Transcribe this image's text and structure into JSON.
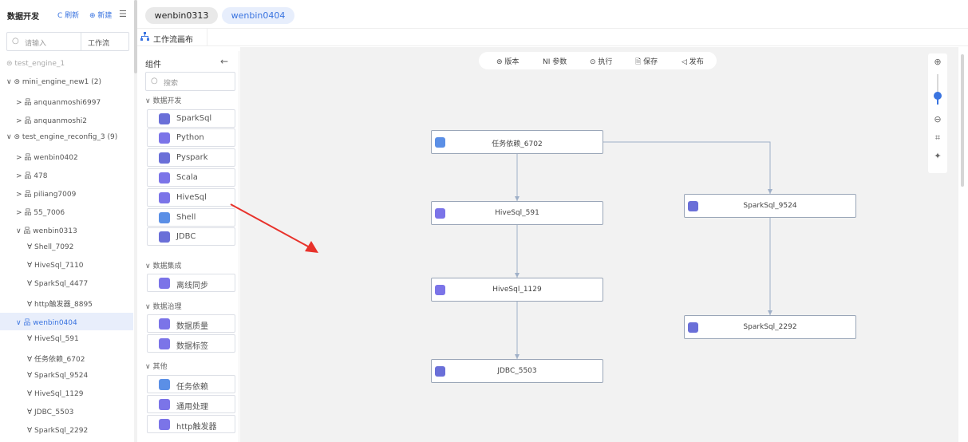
{
  "left_panel": {
    "title": "数据开发",
    "refresh_label": "C 刷新",
    "new_label": "⊕ 新建",
    "search_placeholder": "请输入",
    "filter_value": "工作流",
    "tree": [
      {
        "label": "⊜ test_engine_1",
        "state": "muted"
      },
      {
        "label": "∨ ⊜ mini_engine_new1 (2)"
      },
      {
        "label": "> 品 anquanmoshi6997"
      },
      {
        "label": "> 品 anquanmoshi2"
      },
      {
        "label": "∨ ⊜ test_engine_reconfig_3 (9)"
      },
      {
        "label": "> 品 wenbin0402"
      },
      {
        "label": "> 品 478"
      },
      {
        "label": "> 品 piliang7009"
      },
      {
        "label": "> 品 55_7006"
      },
      {
        "label": "∨ 品 wenbin0313"
      },
      {
        "label": "∀ Shell_7092"
      },
      {
        "label": "∀ HiveSql_7110"
      },
      {
        "label": "∀ SparkSql_4477"
      },
      {
        "label": "∀ http触发器_8895"
      },
      {
        "label": "∨ 品 wenbin0404",
        "state": "selected"
      },
      {
        "label": "∀ HiveSql_591"
      },
      {
        "label": "∀ 任务依赖_6702"
      },
      {
        "label": "∀ SparkSql_9524"
      },
      {
        "label": "∀ HiveSql_1129"
      },
      {
        "label": "∀ JDBC_5503"
      },
      {
        "label": "∀ SparkSql_2292"
      }
    ]
  },
  "tabs": [
    {
      "label": "wenbin0313",
      "active": false
    },
    {
      "label": "wenbin0404",
      "active": true
    }
  ],
  "subtab": {
    "label": "工作流画布"
  },
  "palette": {
    "title": "组件",
    "search_placeholder": "搜索",
    "groups": [
      {
        "label": "∨ 数据开发",
        "items": [
          {
            "label": "SparkSql",
            "icon": "spark-icon",
            "color": "#6a6fd8"
          },
          {
            "label": "Python",
            "icon": "python-icon",
            "color": "#7b74e8"
          },
          {
            "label": "Pyspark",
            "icon": "pyspark-icon",
            "color": "#6a6fd8"
          },
          {
            "label": "Scala",
            "icon": "scala-icon",
            "color": "#7b74e8"
          },
          {
            "label": "HiveSql",
            "icon": "hive-icon",
            "color": "#7b74e8"
          },
          {
            "label": "Shell",
            "icon": "shell-icon",
            "color": "#5b8fe6"
          },
          {
            "label": "JDBC",
            "icon": "jdbc-icon",
            "color": "#6a6fd8"
          }
        ]
      },
      {
        "label": "∨ 数据集成",
        "items": [
          {
            "label": "离线同步",
            "icon": "sync-icon",
            "color": "#7b74e8"
          }
        ]
      },
      {
        "label": "∨ 数据治理",
        "items": [
          {
            "label": "数据质量",
            "icon": "quality-icon",
            "color": "#7b74e8"
          },
          {
            "label": "数据标签",
            "icon": "tag-icon",
            "color": "#7b74e8"
          }
        ]
      },
      {
        "label": "∨ 其他",
        "items": [
          {
            "label": "任务依赖",
            "icon": "dependency-icon",
            "color": "#5b8fe6"
          },
          {
            "label": "通用处理",
            "icon": "general-icon",
            "color": "#7b74e8"
          },
          {
            "label": "http触发器",
            "icon": "http-icon",
            "color": "#7b74e8"
          }
        ]
      }
    ]
  },
  "toolbar": {
    "version": "⊜ 版本",
    "params": "NI 参数",
    "run": "⊙ 执行",
    "save": "🗎 保存",
    "publish": "◁ 发布"
  },
  "nodes": [
    {
      "id": "dep",
      "label": "任务依赖_6702",
      "icon": "dependency-icon",
      "color": "#5b8fe6"
    },
    {
      "id": "hive591",
      "label": "HiveSql_591",
      "icon": "hive-icon",
      "color": "#7b74e8"
    },
    {
      "id": "hive1129",
      "label": "HiveSql_1129",
      "icon": "hive-icon",
      "color": "#7b74e8"
    },
    {
      "id": "jdbc",
      "label": "JDBC_5503",
      "icon": "jdbc-icon",
      "color": "#6a6fd8"
    },
    {
      "id": "spark9524",
      "label": "SparkSql_9524",
      "icon": "spark-icon",
      "color": "#6a6fd8"
    },
    {
      "id": "spark2292",
      "label": "SparkSql_2292",
      "icon": "spark-icon",
      "color": "#6a6fd8"
    }
  ],
  "zoom": {
    "zoom_in": "⊕",
    "zoom_out": "⊖",
    "fit": "⌗",
    "layout": "✦",
    "level": 0.3
  },
  "colors": {
    "accent": "#3a74e0",
    "arrow": "#e8322b",
    "edge": "#9fb0c8"
  }
}
